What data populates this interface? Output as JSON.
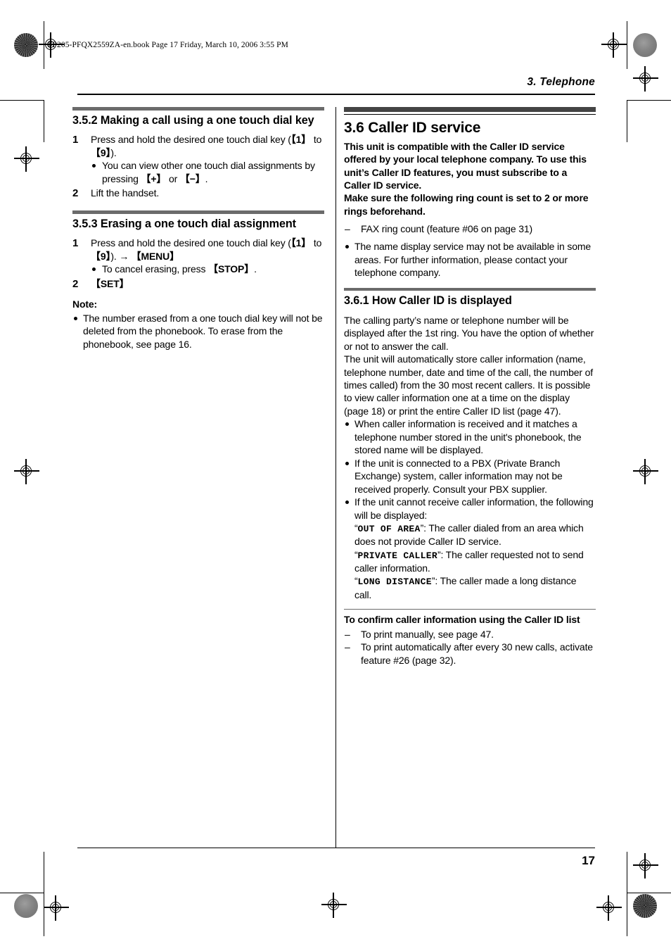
{
  "page": {
    "bookmark_line": "FP205-PFQX2559ZA-en.book  Page 17  Friday, March 10, 2006  3:55 PM",
    "running_head": "3. Telephone",
    "page_number": "17"
  },
  "left_column": {
    "section_352": {
      "heading": "3.5.2 Making a call using a one touch dial key",
      "steps": [
        {
          "num": "1",
          "text_before": "Press and hold the desired one touch dial key (",
          "key_a": "【1】",
          "text_mid": " to ",
          "key_b": "【9】",
          "text_after": ").",
          "bullets": [
            {
              "text_before": "You can view other one touch dial assignments by pressing ",
              "key_a": "【+】",
              "text_mid": " or ",
              "key_b": "【−】",
              "text_after": "."
            }
          ]
        },
        {
          "num": "2",
          "text": "Lift the handset."
        }
      ]
    },
    "section_353": {
      "heading": "3.5.3 Erasing a one touch dial assignment",
      "step1": {
        "num": "1",
        "text_before": "Press and hold the desired one touch dial key (",
        "key_a": "【1】",
        "text_mid": " to ",
        "key_b": "【9】",
        "text_after": "). ",
        "arrow": "→",
        "key_menu": "【MENU】",
        "bullet_before": "To cancel erasing, press ",
        "bullet_key": "【STOP】",
        "bullet_after": "."
      },
      "step2": {
        "num": "2",
        "key": "【SET】"
      },
      "note_label": "Note:",
      "note_bullets": [
        "The number erased from a one touch dial key will not be deleted from the phonebook. To erase from the phonebook, see page 16."
      ]
    }
  },
  "right_column": {
    "section_36": {
      "heading": "3.6 Caller ID service",
      "lead_paragraphs": [
        "This unit is compatible with the Caller ID service offered by your local telephone company. To use this unit’s Caller ID features, you must subscribe to a Caller ID service.",
        "Make sure the following ring count is set to 2 or more rings beforehand."
      ],
      "dashes": [
        "FAX ring count (feature #06 on page 31)"
      ],
      "bullets": [
        "The name display service may not be available in some areas. For further information, please contact your telephone company."
      ]
    },
    "section_361": {
      "heading": "3.6.1 How Caller ID is displayed",
      "paragraphs": [
        "The calling party’s name or telephone number will be displayed after the 1st ring. You have the option of whether or not to answer the call.",
        "The unit will automatically store caller information (name, telephone number, date and time of the call, the number of times called) from the 30 most recent callers. It is possible to view caller information one at a time on the display (page 18) or print the entire Caller ID list (page 47)."
      ],
      "bullets": [
        {
          "text": "When caller information is received and it matches a telephone number stored in the unit's phonebook, the stored name will be displayed."
        },
        {
          "text": "If the unit is connected to a PBX (Private Branch Exchange) system, caller information may not be received properly. Consult your PBX supplier."
        },
        {
          "text": "If the unit cannot receive caller information, the following will be displayed:",
          "displays": [
            {
              "quote_open": "“",
              "code": "OUT OF AREA",
              "quote_close": "”",
              "desc": ": The caller dialed from an area which does not provide Caller ID service."
            },
            {
              "quote_open": "“",
              "code": "PRIVATE CALLER",
              "quote_close": "”",
              "desc": ": The caller requested not to send caller information."
            },
            {
              "quote_open": "“",
              "code": "LONG DISTANCE",
              "quote_close": "”",
              "desc": ": The caller made a long distance call."
            }
          ]
        }
      ],
      "confirm_heading": "To confirm caller information using the Caller ID list",
      "confirm_dashes": [
        "To print manually, see page 47.",
        "To print automatically after every 30 new calls, activate feature #26 (page 32)."
      ]
    }
  }
}
